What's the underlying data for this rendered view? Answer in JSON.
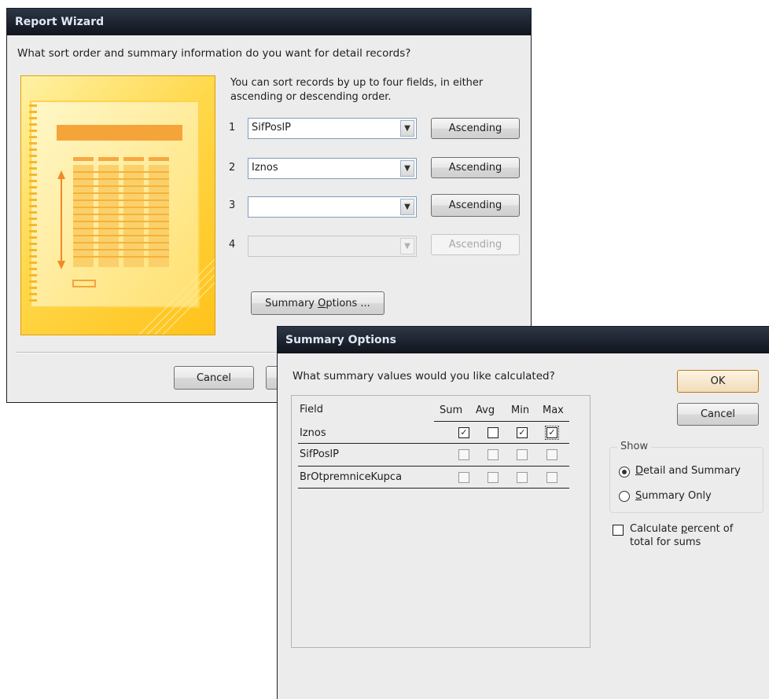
{
  "report_wizard": {
    "title": "Report Wizard",
    "question": "What sort order and summary information do you want for detail records?",
    "info_line1": "You can sort records by up to four fields, in either",
    "info_line2": "ascending or descending order.",
    "sort_rows": [
      {
        "num": "1",
        "field": "SifPoslP",
        "order": "Ascending",
        "enabled": true
      },
      {
        "num": "2",
        "field": "Iznos",
        "order": "Ascending",
        "enabled": true
      },
      {
        "num": "3",
        "field": "",
        "order": "Ascending",
        "enabled": true
      },
      {
        "num": "4",
        "field": "",
        "order": "Ascending",
        "enabled": false
      }
    ],
    "summary_options_pre": "Summary ",
    "summary_options_key": "O",
    "summary_options_post": "ptions ...",
    "cancel_label": "Cancel"
  },
  "summary_options": {
    "title": "Summary Options",
    "question": "What summary values would you like calculated?",
    "columns": {
      "field": "Field",
      "sum": "Sum",
      "avg": "Avg",
      "min": "Min",
      "max": "Max"
    },
    "rows": [
      {
        "field": "Iznos",
        "sum": true,
        "avg": false,
        "min": true,
        "max": true
      },
      {
        "field": "SifPoslP",
        "sum": false,
        "avg": false,
        "min": false,
        "max": false
      },
      {
        "field": "BrOtpremniceKupca",
        "sum": false,
        "avg": false,
        "min": false,
        "max": false
      }
    ],
    "ok_label": "OK",
    "cancel_label": "Cancel",
    "show_label": "Show",
    "detail_key": "D",
    "detail_rest": "etail and Summary",
    "summary_only_key": "S",
    "summary_only_rest": "ummary Only",
    "show_selected": "detail",
    "percent_line1_pre": "Calculate ",
    "percent_line1_key": "p",
    "percent_line1_post": "ercent of",
    "percent_line2": "total for sums",
    "percent_checked": false
  }
}
